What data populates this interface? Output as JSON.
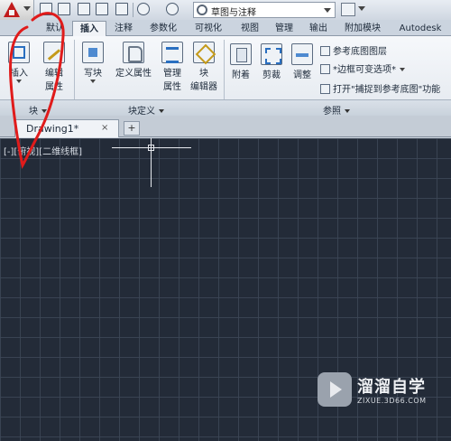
{
  "workspace": {
    "current": "草图与注释"
  },
  "ribbon_tabs": [
    "默认",
    "插入",
    "注释",
    "参数化",
    "可视化",
    "视图",
    "管理",
    "输出",
    "附加模块",
    "Autodesk"
  ],
  "active_tab": "插入",
  "ribbon": {
    "block_panel": {
      "insert_label": "插入",
      "edit_attr_label_1": "编辑",
      "edit_attr_label_2": "属性",
      "label": "块"
    },
    "block_def_panel": {
      "write_block": "写块",
      "define_attr": "定义属性",
      "manage_attr_1": "管理",
      "manage_attr_2": "属性",
      "block_editor_1": "块",
      "block_editor_2": "编辑器",
      "label": "块定义"
    },
    "reference_panel": {
      "attach": "附着",
      "clip": "剪裁",
      "adjust": "调整",
      "underlay_layers": "参考底图图层",
      "frame_variable": "*边框可变选项*",
      "snap_underlay": "打开\"捕捉到参考底图\"功能",
      "label": "参照"
    }
  },
  "document_tab": {
    "label": "Drawing1*",
    "close": "×",
    "new_tab": "+"
  },
  "viewport": {
    "label": "[-][俯视][二维线框]"
  },
  "watermark": {
    "title": "溜溜自学",
    "url": "ZIXUE.3D66.COM"
  },
  "colors": {
    "canvas_bg": "#232b38",
    "annotation_red": "#e01b1b",
    "app_red": "#c11b1b"
  }
}
